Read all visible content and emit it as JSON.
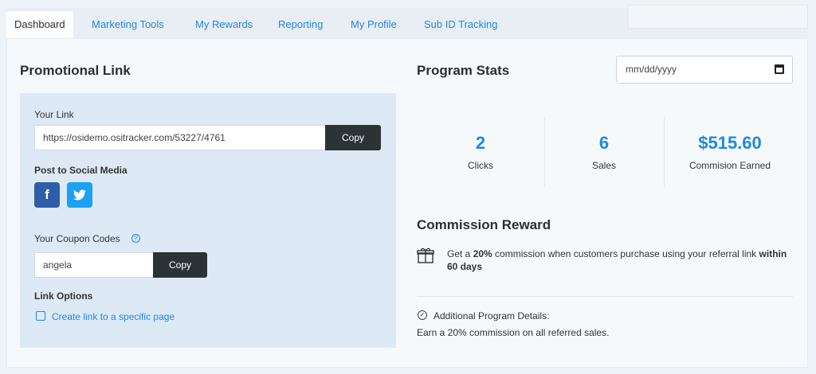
{
  "tabs": [
    {
      "label": "Dashboard",
      "active": true
    },
    {
      "label": "Marketing Tools"
    },
    {
      "label": "My Rewards"
    },
    {
      "label": "Reporting"
    },
    {
      "label": "My Profile"
    },
    {
      "label": "Sub ID Tracking"
    }
  ],
  "promo": {
    "title": "Promotional Link",
    "your_link_label": "Your Link",
    "link_value": "https://osidemo.ositracker.com/53227/4761",
    "copy_label": "Copy",
    "social_label": "Post to Social Media",
    "coupon_label": "Your Coupon Codes",
    "coupon_value": "angela",
    "link_options_label": "Link Options",
    "create_link": "Create link to a specific page"
  },
  "stats": {
    "title": "Program Stats",
    "date_placeholder": "mm/dd/yyyy",
    "items": [
      {
        "value": "2",
        "label": "Clicks"
      },
      {
        "value": "6",
        "label": "Sales"
      },
      {
        "value": "$515.60",
        "label": "Commision Earned"
      }
    ]
  },
  "reward": {
    "title": "Commission Reward",
    "text_pre": "Get a ",
    "text_pct": "20%",
    "text_mid": " commission when customers purchase using your referral link ",
    "text_days": "within 60 days",
    "details_label": "Additional Program Details:",
    "details_text": "Earn a 20% commission on all referred sales."
  },
  "colors": {
    "accent": "#1e88e5",
    "button": "#2b3336",
    "facebook": "#2d5ea8",
    "twitter": "#1da1f2"
  },
  "icons": [
    "info-icon",
    "facebook-icon",
    "twitter-icon",
    "edit-icon",
    "calendar-icon",
    "gift-icon",
    "check-circle-icon"
  ]
}
